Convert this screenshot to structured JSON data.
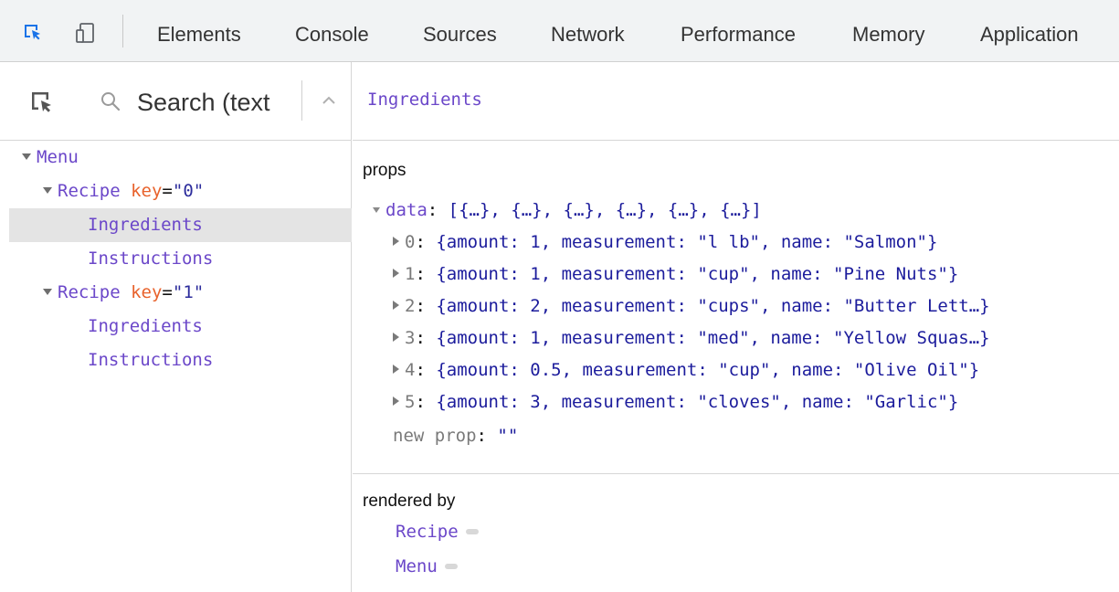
{
  "toolbar": {
    "inspect_icon": "element-picker-icon",
    "device_icon": "device-toggle-icon",
    "tabs": [
      "Elements",
      "Console",
      "Sources",
      "Network",
      "Performance",
      "Memory",
      "Application"
    ]
  },
  "search": {
    "placeholder": "Search (text",
    "picker_icon": "component-picker-icon",
    "search_icon": "search-icon",
    "prev_icon": "chevron-up-icon"
  },
  "tree": [
    {
      "label": "Menu",
      "expanded": true
    },
    {
      "label": "Recipe",
      "attr_name": "key",
      "attr_eq": "=",
      "attr_value": "\"0\"",
      "expanded": true
    },
    {
      "label": "Ingredients",
      "selected": true
    },
    {
      "label": "Instructions"
    },
    {
      "label": "Recipe",
      "attr_name": "key",
      "attr_eq": "=",
      "attr_value": "\"1\"",
      "expanded": true
    },
    {
      "label": "Ingredients"
    },
    {
      "label": "Instructions"
    }
  ],
  "details": {
    "title": "Ingredients",
    "props_title": "props",
    "data_key": "data",
    "data_colon": ":",
    "data_summary": "[{…}, {…}, {…}, {…}, {…}, {…}]",
    "items": [
      {
        "index": "0",
        "value": "{amount: 1, measurement: \"l lb\", name: \"Salmon\"}"
      },
      {
        "index": "1",
        "value": "{amount: 1, measurement: \"cup\", name: \"Pine Nuts\"}"
      },
      {
        "index": "2",
        "value": "{amount: 2, measurement: \"cups\", name: \"Butter Lett…}"
      },
      {
        "index": "3",
        "value": "{amount: 1, measurement: \"med\", name: \"Yellow Squas…}"
      },
      {
        "index": "4",
        "value": "{amount: 0.5, measurement: \"cup\", name: \"Olive Oil\"}"
      },
      {
        "index": "5",
        "value": "{amount: 3, measurement: \"cloves\", name: \"Garlic\"}"
      }
    ],
    "new_prop_key": "new prop",
    "new_prop_colon": ":",
    "new_prop_value": "\"\"",
    "rendered_by_title": "rendered by",
    "owners": [
      "Recipe",
      "Menu"
    ]
  },
  "colors": {
    "component": "#6b47c9",
    "attr_name": "#e8622c",
    "value": "#1c1c9c",
    "selected_row": "#e4e4e4"
  }
}
